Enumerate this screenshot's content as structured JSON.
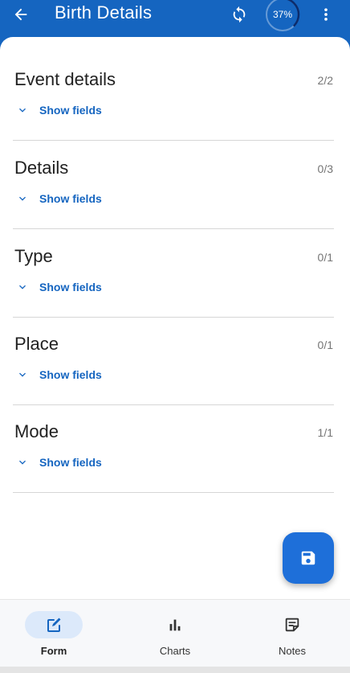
{
  "header": {
    "title": "Birth Details",
    "progress_text": "37%",
    "progress_fraction": 0.37
  },
  "sections": [
    {
      "title": "Event details",
      "count": "2/2",
      "toggle": "Show fields"
    },
    {
      "title": "Details",
      "count": "0/3",
      "toggle": "Show fields"
    },
    {
      "title": "Type",
      "count": "0/1",
      "toggle": "Show fields"
    },
    {
      "title": "Place",
      "count": "0/1",
      "toggle": "Show fields"
    },
    {
      "title": "Mode",
      "count": "1/1",
      "toggle": "Show fields"
    }
  ],
  "bottom_nav": {
    "items": [
      {
        "label": "Form",
        "icon": "edit-form-icon",
        "active": true
      },
      {
        "label": "Charts",
        "icon": "bar-chart-icon",
        "active": false
      },
      {
        "label": "Notes",
        "icon": "notes-icon",
        "active": false
      }
    ]
  },
  "fab": {
    "icon": "save-icon"
  },
  "colors": {
    "primary": "#1565C0",
    "fab": "#1E6FD9",
    "active_nav_bg": "#DCE9FA",
    "text_primary": "#212121",
    "text_secondary": "#757575"
  }
}
